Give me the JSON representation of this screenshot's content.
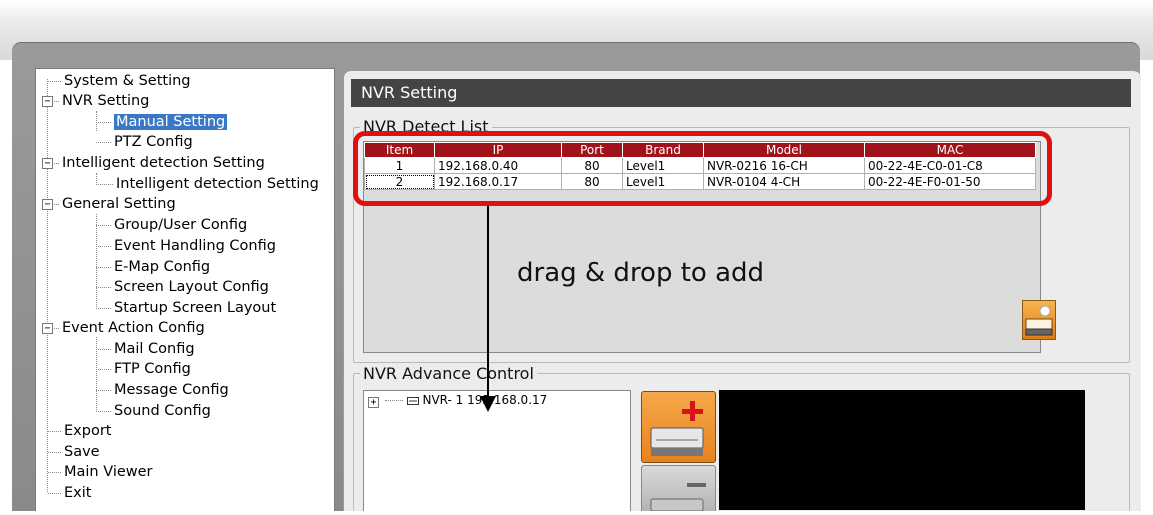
{
  "tree": {
    "items": [
      {
        "label": "System & Setting"
      },
      {
        "label": "NVR  Setting"
      },
      {
        "label": "Manual Setting"
      },
      {
        "label": "PTZ Config"
      },
      {
        "label": "Intelligent detection Setting"
      },
      {
        "label": "Intelligent detection Setting"
      },
      {
        "label": "General Setting"
      },
      {
        "label": "Group/User Config"
      },
      {
        "label": "Event Handling Config"
      },
      {
        "label": "E-Map Config"
      },
      {
        "label": "Screen Layout Config"
      },
      {
        "label": "Startup Screen Layout"
      },
      {
        "label": "Event Action Config"
      },
      {
        "label": "Mail Config"
      },
      {
        "label": "FTP Config"
      },
      {
        "label": "Message Config"
      },
      {
        "label": "Sound Config"
      },
      {
        "label": "Export"
      },
      {
        "label": "Save"
      },
      {
        "label": "Main Viewer"
      },
      {
        "label": "Exit"
      }
    ],
    "selected_index": 2
  },
  "main": {
    "title": "NVR Setting",
    "detect_list": {
      "label": "NVR  Detect List",
      "columns": [
        "Item",
        "IP",
        "Port",
        "Brand",
        "Model",
        "MAC"
      ],
      "rows": [
        [
          "1",
          "192.168.0.40",
          "80",
          "Level1",
          "NVR-0216  16-CH",
          "00-22-4E-C0-01-C8"
        ],
        [
          "2",
          "192.168.0.17",
          "80",
          "Level1",
          "NVR-0104  4-CH",
          "00-22-4E-F0-01-50"
        ]
      ]
    },
    "annotation": "drag & drop to add",
    "advance_control": {
      "label": "NVR  Advance Control",
      "tree_item": "NVR- 1  192.168.0.17"
    }
  },
  "colors": {
    "header_red": "#a0131a",
    "highlight_red": "#e01010",
    "selection_blue": "#3a78c7",
    "button_orange": "#f08a1e"
  },
  "icons": [
    "expand-icon",
    "collapse-icon",
    "nvr-device-icon",
    "add-nvr-icon",
    "remove-nvr-icon",
    "image-icon"
  ]
}
